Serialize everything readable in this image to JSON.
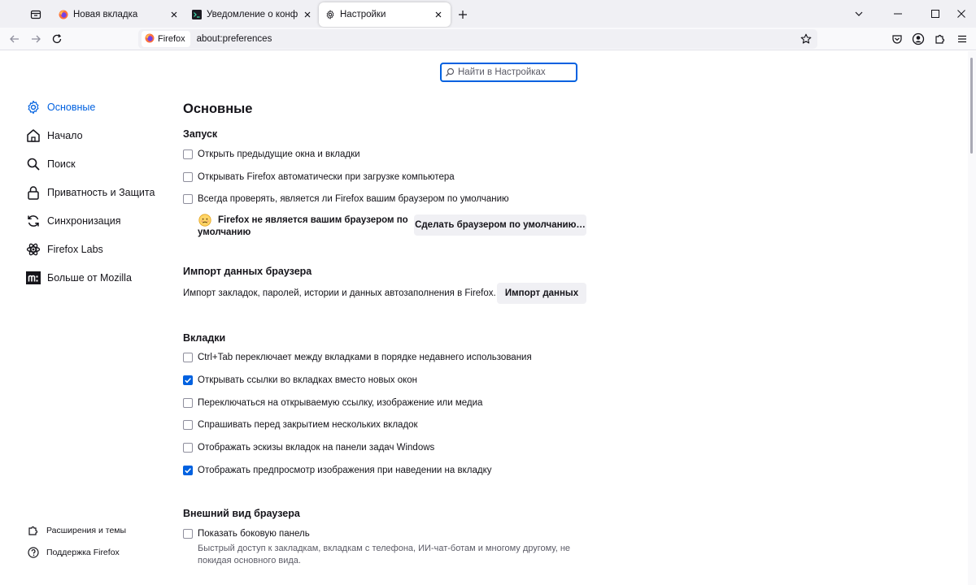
{
  "tabs": [
    {
      "title": "Новая вкладка",
      "icon": "firefox-icon",
      "selected": false
    },
    {
      "title": "Уведомление о конфиденциальности",
      "icon": "terminal-icon",
      "selected": false
    },
    {
      "title": "Настройки",
      "icon": "gear-icon",
      "selected": true
    }
  ],
  "urlbar": {
    "identity_label": "Firefox",
    "url": "about:preferences"
  },
  "search": {
    "placeholder": "Найти в Настройках"
  },
  "sidebar": {
    "categories": [
      {
        "label": "Основные",
        "icon": "gear-icon",
        "active": true
      },
      {
        "label": "Начало",
        "icon": "home-icon"
      },
      {
        "label": "Поиск",
        "icon": "search-icon"
      },
      {
        "label": "Приватность и Защита",
        "icon": "lock-icon"
      },
      {
        "label": "Синхронизация",
        "icon": "sync-icon"
      },
      {
        "label": "Firefox Labs",
        "icon": "labs-icon"
      },
      {
        "label": "Больше от Mozilla",
        "icon": "mozilla-icon"
      }
    ],
    "footer": [
      {
        "label": "Расширения и темы",
        "icon": "puzzle-icon"
      },
      {
        "label": "Поддержка Firefox",
        "icon": "help-icon"
      }
    ]
  },
  "main": {
    "title": "Основные",
    "startup": {
      "heading": "Запуск",
      "options": [
        {
          "label": "Открыть предыдущие окна и вкладки",
          "checked": false
        },
        {
          "label": "Открывать Firefox автоматически при загрузке компьютера",
          "checked": false
        },
        {
          "label": "Всегда проверять, является ли Firefox вашим браузером по умолчанию",
          "checked": false
        }
      ],
      "default_status_line1": "Firefox не является вашим браузером по",
      "default_status_line2": "умолчанию",
      "make_default_button": "Сделать браузером по умолчанию…"
    },
    "import": {
      "heading": "Импорт данных браузера",
      "description": "Импорт закладок, паролей, истории и данных автозаполнения в Firefox.",
      "button": "Импорт данных"
    },
    "tabs_section": {
      "heading": "Вкладки",
      "options": [
        {
          "label": "Ctrl+Tab переключает между вкладками в порядке недавнего использования",
          "checked": false
        },
        {
          "label": "Открывать ссылки во вкладках вместо новых окон",
          "checked": true
        },
        {
          "label": "Переключаться на открываемую ссылку, изображение или медиа",
          "checked": false
        },
        {
          "label": "Спрашивать перед закрытием нескольких вкладок",
          "checked": false
        },
        {
          "label": "Отображать эскизы вкладок на панели задач Windows",
          "checked": false
        },
        {
          "label": "Отображать предпросмотр изображения при наведении на вкладку",
          "checked": true
        }
      ]
    },
    "appearance": {
      "heading": "Внешний вид браузера",
      "option": {
        "label": "Показать боковую панель",
        "checked": false
      },
      "description": "Быстрый доступ к закладкам, вкладкам с телефона, ИИ-чат-ботам и многому другому, не покидая основного вида."
    }
  },
  "colors": {
    "accent": "#0061e0",
    "tabstrip": "#f0f0f4",
    "text": "#15141a"
  }
}
